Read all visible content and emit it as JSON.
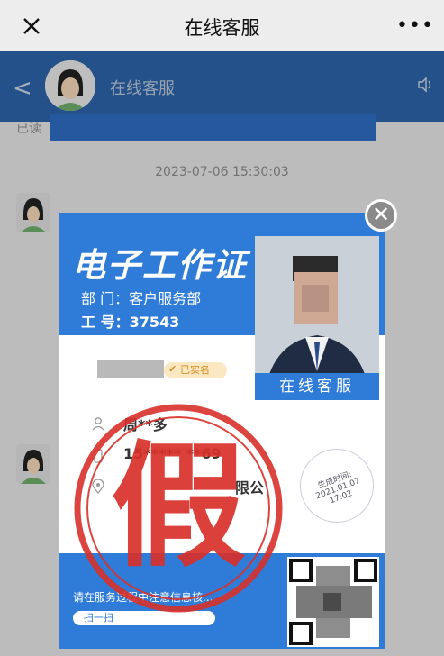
{
  "window": {
    "title": "在线客服",
    "more": "•••"
  },
  "chat_header": {
    "back": "<",
    "title": "在线客服"
  },
  "chat": {
    "read_label": "已读",
    "timestamp": "2023-07-06 15:30:03"
  },
  "card": {
    "title": "电子工作证",
    "department": "部 门：客户服务部",
    "job_number": "工 号：37543",
    "photo_label": "在线客服",
    "verified": "已实名",
    "name_partial": "周**多",
    "phone_partial": "15*****  **69",
    "company_partial": "限公",
    "stamp_text": "生成时间:",
    "stamp_date": "2021.01.07 17:02",
    "notice": "请在服务过程中注意信息核...",
    "scan_label": "扫一扫"
  },
  "seal": {
    "text": "假",
    "color": "#d8312a"
  },
  "colors": {
    "accent": "#2f7bd8",
    "header": "#2c63a8"
  },
  "icons": [
    "close-icon",
    "more-icon",
    "back-icon",
    "speaker-icon",
    "user-icon",
    "phone-icon",
    "location-icon",
    "check-icon",
    "qr-code"
  ]
}
